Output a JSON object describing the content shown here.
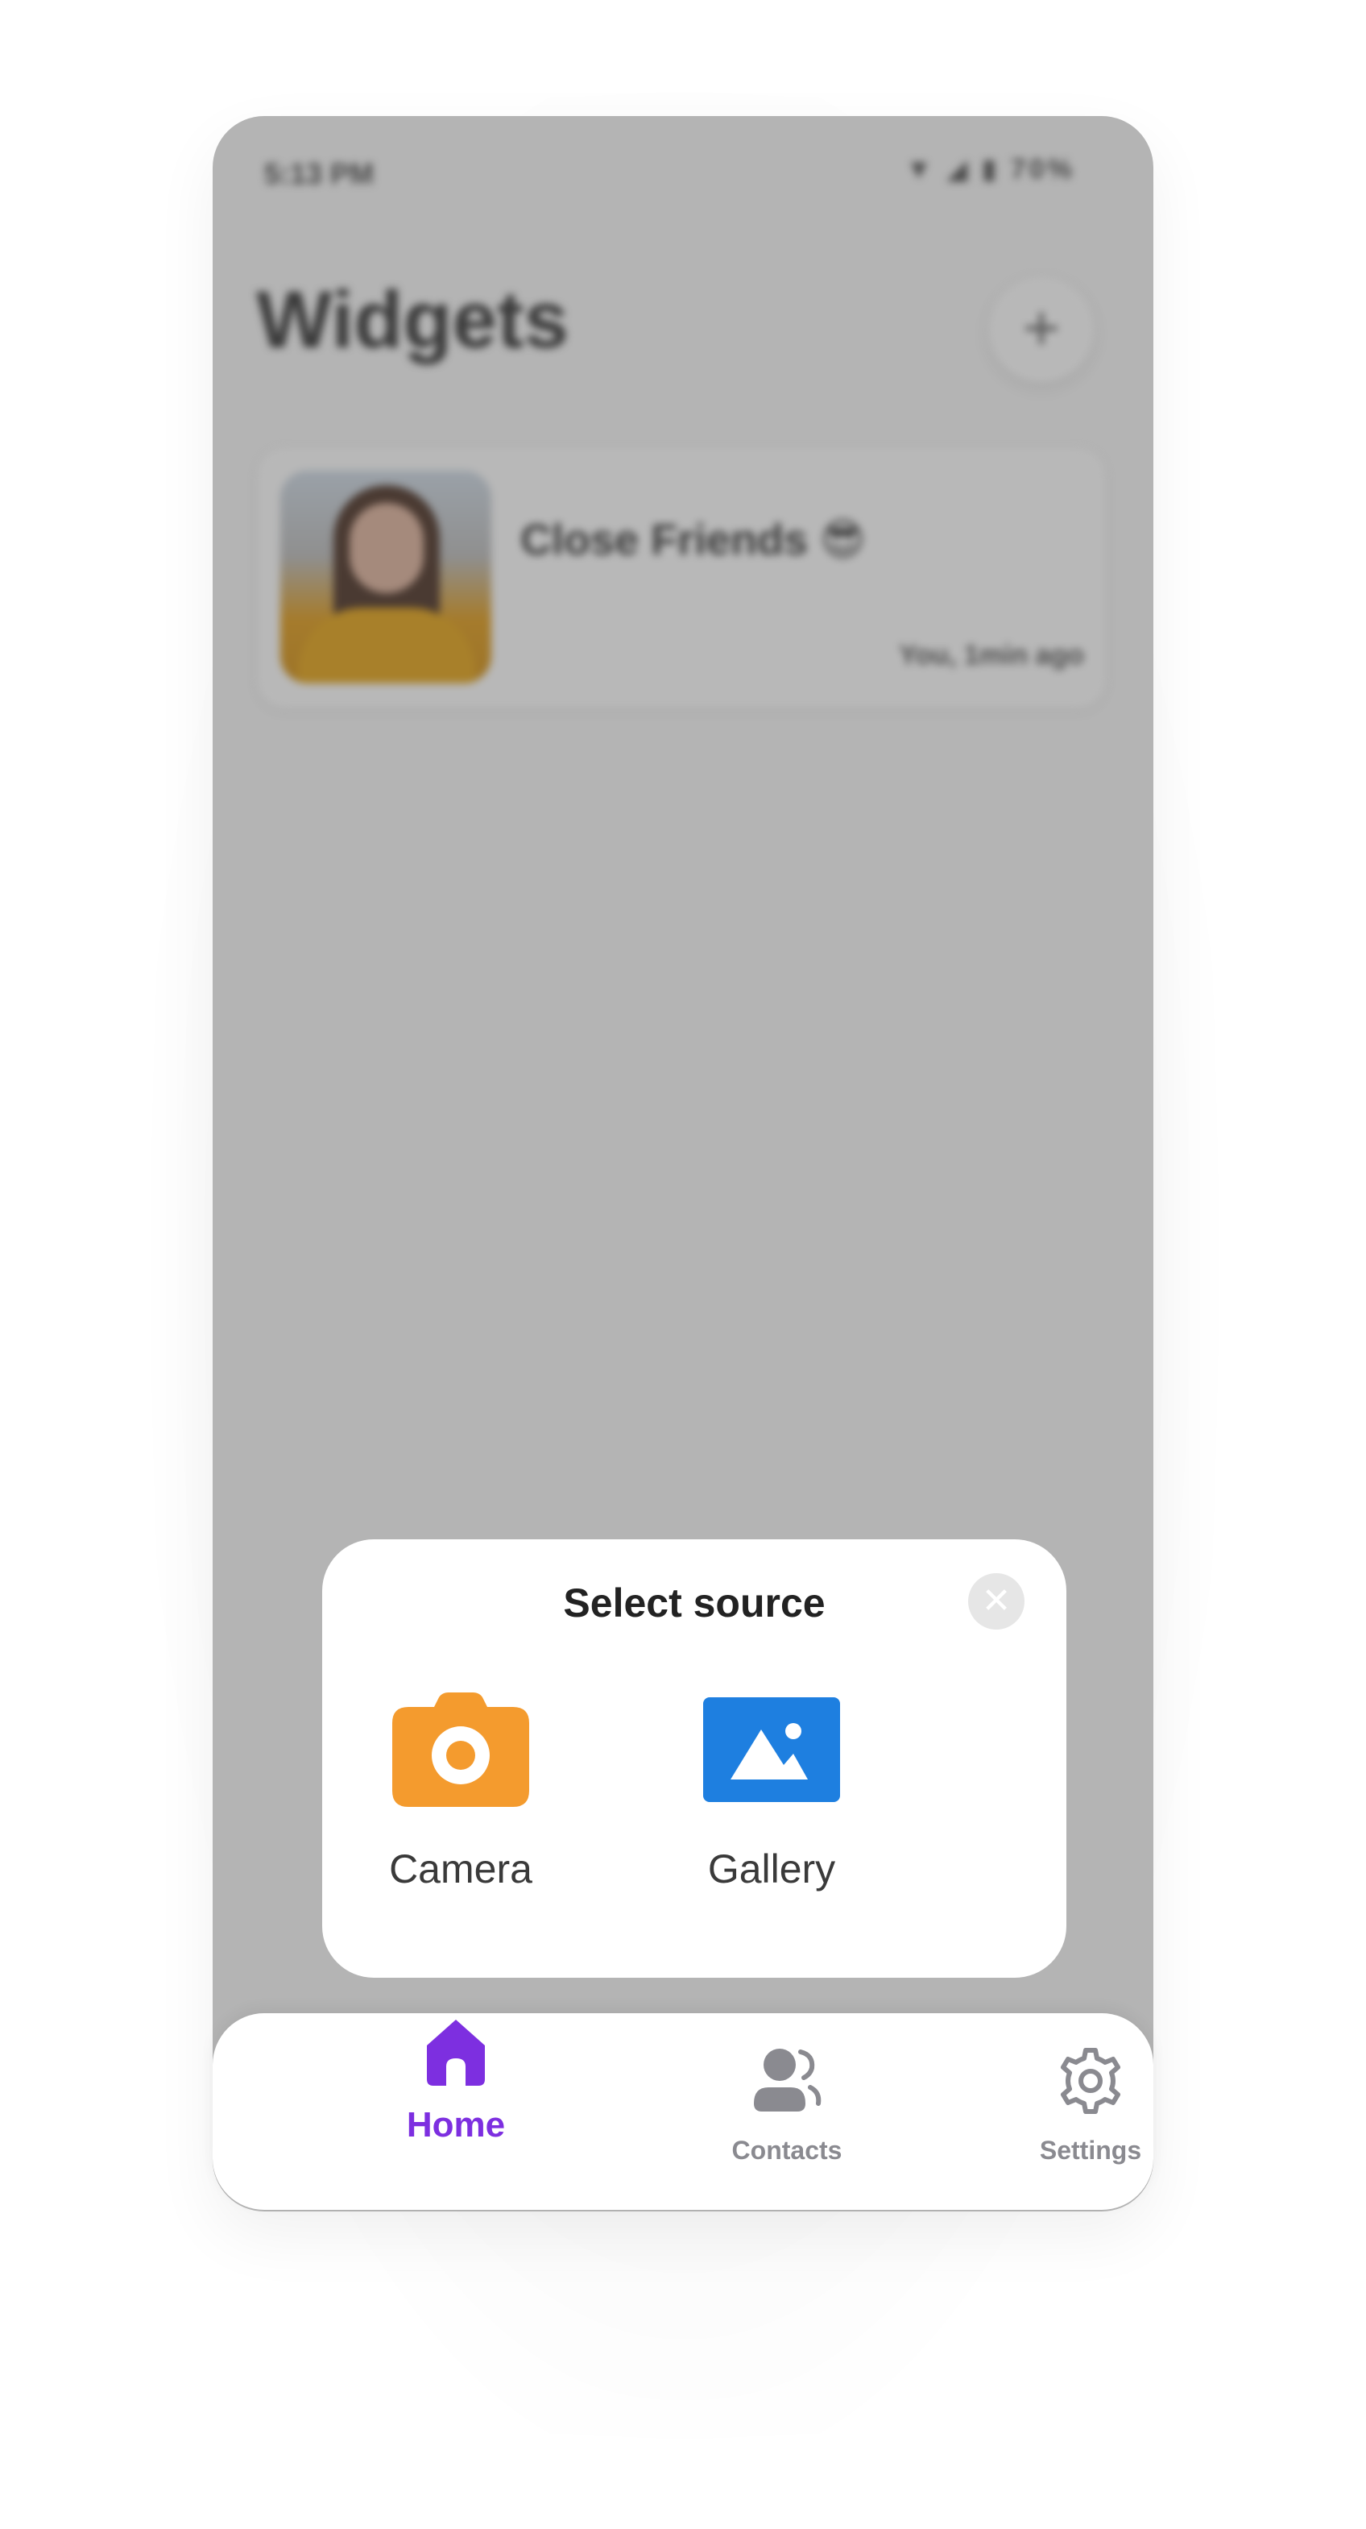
{
  "status_bar": {
    "time": "5:13 PM",
    "battery": "70%"
  },
  "header": {
    "title": "Widgets",
    "add_button_label": "+"
  },
  "widgets": [
    {
      "title": "Close Friends 😎",
      "meta": "You, 1min ago"
    }
  ],
  "dialog": {
    "title": "Select source",
    "close_label": "✕",
    "options": [
      {
        "label": "Camera",
        "icon": "camera-icon",
        "color": "#F49B2E"
      },
      {
        "label": "Gallery",
        "icon": "gallery-icon",
        "color": "#1E7FE0"
      }
    ]
  },
  "bottom_nav": {
    "items": [
      {
        "label": "Home",
        "icon": "home-icon",
        "active": true,
        "color": "#7D2FE0"
      },
      {
        "label": "Contacts",
        "icon": "contacts-icon",
        "active": false,
        "color": "#8A8A90"
      },
      {
        "label": "Settings",
        "icon": "gear-icon",
        "active": false,
        "color": "#8A8A90"
      }
    ]
  },
  "colors": {
    "overlay": "#B4B4B4",
    "accent": "#7D2FE0"
  }
}
